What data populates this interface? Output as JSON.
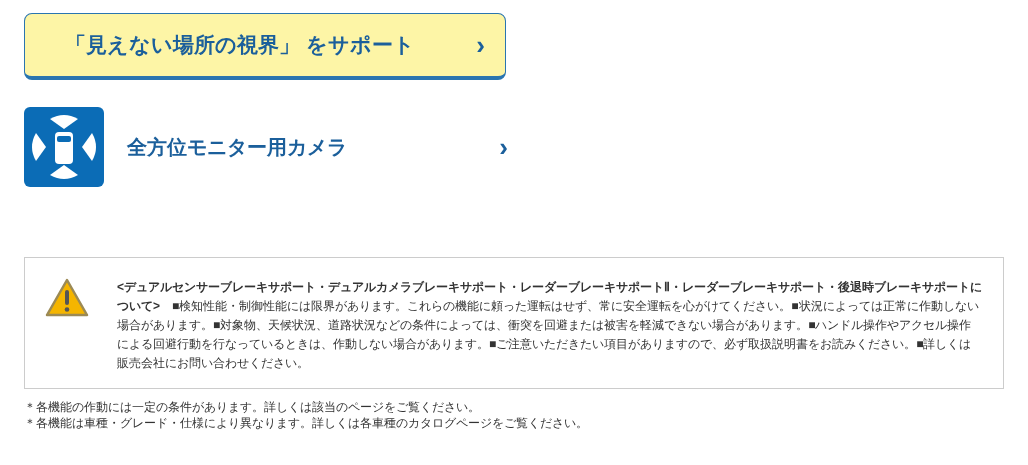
{
  "support_button": {
    "label": "「見えない場所の視界」 をサポート",
    "chevron": "›"
  },
  "feature_link": {
    "label": "全方位モニター用カメラ",
    "chevron": "›"
  },
  "notice": {
    "text": "**<デュアルセンサーブレーキサポート・デュアルカメラブレーキサポート・レーダーブレーキサポートⅡ・レーダーブレーキサポート・後退時ブレーキサポートについて>**　■検知性能・制御性能には限界があります。これらの機能に頼った運転はせず、常に安全運転を心がけてください。■状況によっては正常に作動しない場合があります。■対象物、天候状況、道路状況などの条件によっては、衝突を回避または被害を軽減できない場合があります。■ハンドル操作やアクセル操作による回避行動を行なっているときは、作動しない場合があります。■ご注意いただきたい項目がありますので、必ず取扱説明書をお読みください。■詳しくは販売会社にお問い合わせください。"
  },
  "footnotes": [
    "＊各機能の作動には一定の条件があります。詳しくは該当のページをご覧ください。",
    "＊各機能は車種・グレード・仕様により異なります。詳しくは各車種のカタログページをご覧ください。"
  ]
}
